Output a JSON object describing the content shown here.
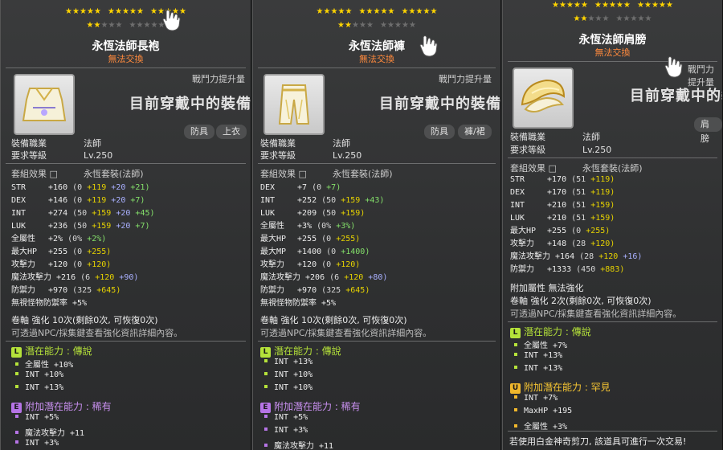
{
  "colors": {
    "stars_on": "#ffd400",
    "untradeable": "#ff8a3d",
    "legendary": "#b5e23a",
    "epic": "#b674e6",
    "unique": "#f0b72c"
  },
  "panels": [
    {
      "stars": {
        "filled": 17,
        "total": 25
      },
      "item_name": "永恆法師長袍",
      "untradeable": "無法交換",
      "gain_label": "戰鬥力提升量",
      "equipped_text": "目前穿戴中的裝備",
      "tags": [
        "防具",
        "上衣"
      ],
      "job_label": "裝備職業",
      "job_value": "法師",
      "level_label": "要求等級",
      "level_value": "Lv.250",
      "set_label": "套組效果",
      "set_value": "永恆套裝(法師)",
      "stats": [
        {
          "name": "STR",
          "total": "+160",
          "parts": [
            [
              "(0",
              "gray"
            ],
            [
              "+119",
              "yellow"
            ],
            [
              "+20",
              "blue"
            ],
            [
              "+21)",
              "green"
            ]
          ]
        },
        {
          "name": "DEX",
          "total": "+146",
          "parts": [
            [
              "(0",
              "gray"
            ],
            [
              "+119",
              "yellow"
            ],
            [
              "+20",
              "blue"
            ],
            [
              "+7)",
              "green"
            ]
          ]
        },
        {
          "name": "INT",
          "total": "+274",
          "parts": [
            [
              "(50",
              "gray"
            ],
            [
              "+159",
              "yellow"
            ],
            [
              "+20",
              "blue"
            ],
            [
              "+45)",
              "green"
            ]
          ]
        },
        {
          "name": "LUK",
          "total": "+236",
          "parts": [
            [
              "(50",
              "gray"
            ],
            [
              "+159",
              "yellow"
            ],
            [
              "+20",
              "blue"
            ],
            [
              "+7)",
              "green"
            ]
          ]
        },
        {
          "name": "全屬性",
          "total": "+2%",
          "parts": [
            [
              "(0%",
              "gray"
            ],
            [
              "+2%)",
              "green"
            ]
          ]
        },
        {
          "name": "最大HP",
          "total": "+255",
          "parts": [
            [
              "(0",
              "gray"
            ],
            [
              "+255)",
              "yellow"
            ]
          ]
        },
        {
          "name": "攻擊力",
          "total": "+120",
          "parts": [
            [
              "(0",
              "gray"
            ],
            [
              "+120)",
              "yellow"
            ]
          ]
        },
        {
          "name": "魔法攻擊力",
          "total": "+216",
          "parts": [
            [
              "(6",
              "gray"
            ],
            [
              "+120",
              "yellow"
            ],
            [
              "+90)",
              "blue"
            ]
          ]
        },
        {
          "name": "防禦力",
          "total": "+970",
          "parts": [
            [
              "(325",
              "gray"
            ],
            [
              "+645)",
              "yellow"
            ]
          ]
        },
        {
          "name": "無視怪物防禦率",
          "total": "+5%",
          "parts": []
        }
      ],
      "scroll_line": "卷軸 強化 10次(剩餘0次, 可恢復0次)",
      "hint_line": "可透過NPC/採集鍵查看強化資訊詳細內容。",
      "potentials": [
        {
          "grade": "L",
          "badge": "L",
          "title": "潛在能力 : 傳說",
          "lines": [
            "全屬性 +10%",
            "INT +10%",
            "INT +13%"
          ]
        },
        {
          "grade": "E",
          "badge": "E",
          "title": "附加潛在能力 : 稀有",
          "lines": [
            "INT +5%",
            "魔法攻擊力 +11",
            "INT +3%"
          ]
        }
      ],
      "footer": ""
    },
    {
      "stars": {
        "filled": 17,
        "total": 25
      },
      "item_name": "永恆法師褲",
      "untradeable": "無法交換",
      "gain_label": "戰鬥力提升量",
      "equipped_text": "目前穿戴中的裝備",
      "tags": [
        "防具",
        "褲/裙"
      ],
      "job_label": "裝備職業",
      "job_value": "法師",
      "level_label": "要求等級",
      "level_value": "Lv.250",
      "set_label": "套組效果",
      "set_value": "永恆套裝(法師)",
      "stats": [
        {
          "name": "DEX",
          "total": "+7",
          "parts": [
            [
              "(0",
              "gray"
            ],
            [
              "+7)",
              "green"
            ]
          ]
        },
        {
          "name": "INT",
          "total": "+252",
          "parts": [
            [
              "(50",
              "gray"
            ],
            [
              "+159",
              "yellow"
            ],
            [
              "+43)",
              "green"
            ]
          ]
        },
        {
          "name": "LUK",
          "total": "+209",
          "parts": [
            [
              "(50",
              "gray"
            ],
            [
              "+159)",
              "yellow"
            ]
          ]
        },
        {
          "name": "全屬性",
          "total": "+3%",
          "parts": [
            [
              "(0%",
              "gray"
            ],
            [
              "+3%)",
              "green"
            ]
          ]
        },
        {
          "name": "最大HP",
          "total": "+255",
          "parts": [
            [
              "(0",
              "gray"
            ],
            [
              "+255)",
              "yellow"
            ]
          ]
        },
        {
          "name": "最大MP",
          "total": "+1400",
          "parts": [
            [
              "(0",
              "gray"
            ],
            [
              "+1400)",
              "green"
            ]
          ]
        },
        {
          "name": "攻擊力",
          "total": "+120",
          "parts": [
            [
              "(0",
              "gray"
            ],
            [
              "+120)",
              "yellow"
            ]
          ]
        },
        {
          "name": "魔法攻擊力",
          "total": "+206",
          "parts": [
            [
              "(6",
              "gray"
            ],
            [
              "+120",
              "yellow"
            ],
            [
              "+80)",
              "blue"
            ]
          ]
        },
        {
          "name": "防禦力",
          "total": "+970",
          "parts": [
            [
              "(325",
              "gray"
            ],
            [
              "+645)",
              "yellow"
            ]
          ]
        },
        {
          "name": "無視怪物防禦率",
          "total": "+5%",
          "parts": []
        }
      ],
      "scroll_line": "卷軸 強化 10次(剩餘0次, 可恢復0次)",
      "hint_line": "可透過NPC/採集鍵查看強化資訊詳細內容。",
      "potentials": [
        {
          "grade": "L",
          "badge": "L",
          "title": "潛在能力 : 傳說",
          "lines": [
            "INT +13%",
            "INT +10%",
            "INT +10%"
          ]
        },
        {
          "grade": "E",
          "badge": "E",
          "title": "附加潛在能力 : 稀有",
          "lines": [
            "INT +5%",
            "INT +3%",
            "魔法攻擊力 +11"
          ]
        }
      ],
      "footer": ""
    },
    {
      "stars": {
        "filled": 17,
        "total": 25
      },
      "item_name": "永恆法師肩膀",
      "untradeable": "無法交換",
      "gain_label": "戰鬥力提升量",
      "equipped_text": "目前穿戴中的裝備",
      "tags": [
        "肩膀"
      ],
      "job_label": "裝備職業",
      "job_value": "法師",
      "level_label": "要求等級",
      "level_value": "Lv.250",
      "set_label": "套組效果",
      "set_value": "永恆套裝(法師)",
      "stats": [
        {
          "name": "STR",
          "total": "+170",
          "parts": [
            [
              "(51",
              "gray"
            ],
            [
              "+119)",
              "yellow"
            ]
          ]
        },
        {
          "name": "DEX",
          "total": "+170",
          "parts": [
            [
              "(51",
              "gray"
            ],
            [
              "+119)",
              "yellow"
            ]
          ]
        },
        {
          "name": "INT",
          "total": "+210",
          "parts": [
            [
              "(51",
              "gray"
            ],
            [
              "+159)",
              "yellow"
            ]
          ]
        },
        {
          "name": "LUK",
          "total": "+210",
          "parts": [
            [
              "(51",
              "gray"
            ],
            [
              "+159)",
              "yellow"
            ]
          ]
        },
        {
          "name": "最大HP",
          "total": "+255",
          "parts": [
            [
              "(0",
              "gray"
            ],
            [
              "+255)",
              "yellow"
            ]
          ]
        },
        {
          "name": "攻擊力",
          "total": "+148",
          "parts": [
            [
              "(28",
              "gray"
            ],
            [
              "+120)",
              "yellow"
            ]
          ]
        },
        {
          "name": "魔法攻擊力",
          "total": "+164",
          "parts": [
            [
              "(28",
              "gray"
            ],
            [
              "+120",
              "yellow"
            ],
            [
              "+16)",
              "blue"
            ]
          ]
        },
        {
          "name": "防禦力",
          "total": "+1333",
          "parts": [
            [
              "(450",
              "gray"
            ],
            [
              "+883)",
              "yellow"
            ]
          ]
        }
      ],
      "extra_line": "附加屬性 無法強化",
      "scroll_line": "卷軸 強化 2次(剩餘0次, 可恢復0次)",
      "hint_line": "可透過NPC/採集鍵查看強化資訊詳細內容。",
      "potentials": [
        {
          "grade": "L",
          "badge": "L",
          "title": "潛在能力 : 傳說",
          "lines": [
            "全屬性 +7%",
            "INT +13%",
            "INT +13%"
          ]
        },
        {
          "grade": "U",
          "badge": "U",
          "title": "附加潛在能力 : 罕見",
          "lines": [
            "INT +7%",
            "MaxHP +195",
            "全屬性 +3%"
          ]
        }
      ],
      "footer": "若使用白金神奇剪刀, 該道具可進行一次交易!"
    }
  ]
}
